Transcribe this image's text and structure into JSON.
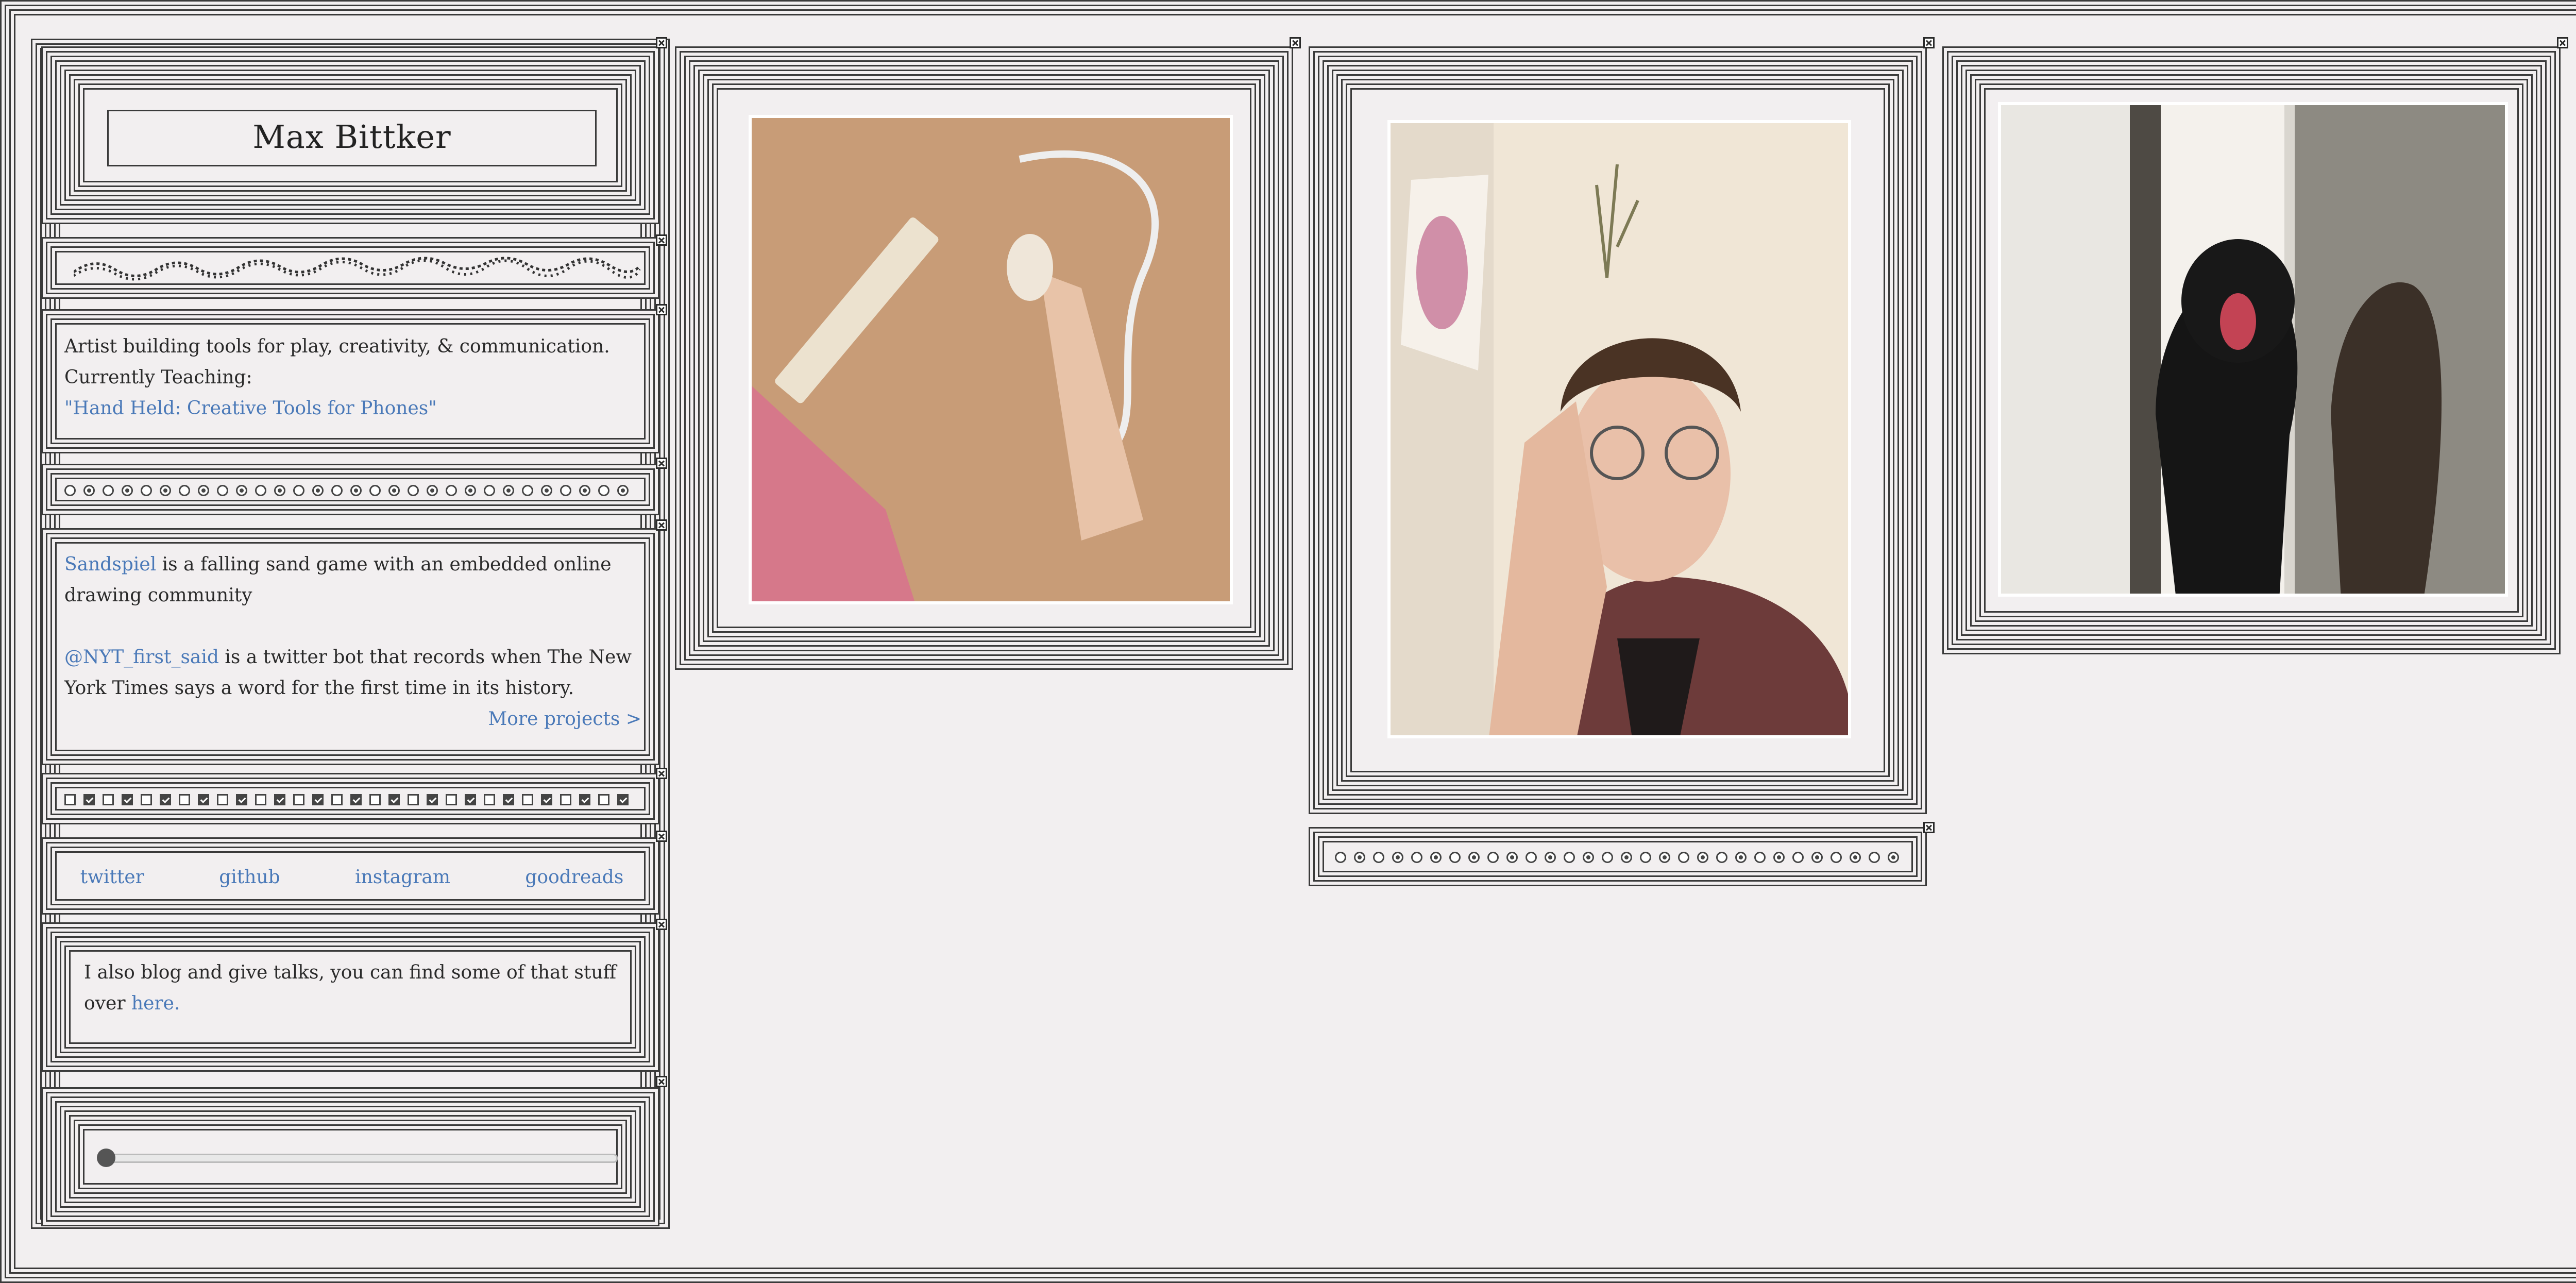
{
  "profile": {
    "name": "Max Bittker"
  },
  "bio": {
    "line1": "Artist building tools for play, creativity, & communication.",
    "line2": "Currently Teaching:",
    "course_link": "\"Hand Held: Creative Tools for Phones\""
  },
  "projects": {
    "p1_link": "Sandspiel",
    "p1_text": " is a falling sand game with an embedded online drawing community",
    "p2_link": "@NYT_first_said",
    "p2_text": " is a twitter bot that records when The New York Times says a word for the first time in its history.",
    "more": "More projects >"
  },
  "social": {
    "twitter": "twitter",
    "github": "github",
    "instagram": "instagram",
    "goodreads": "goodreads"
  },
  "blog": {
    "text": "I also blog and give talks, you can find some of that stuff over ",
    "link": "here."
  },
  "radio_row_1": [
    false,
    true,
    false,
    true,
    false,
    true,
    false,
    true,
    false,
    true,
    false,
    true,
    false,
    true,
    false,
    true,
    false,
    true,
    false,
    true,
    false,
    true,
    false,
    true,
    false,
    true,
    false,
    true,
    false,
    true
  ],
  "check_row": [
    false,
    true,
    false,
    true,
    false,
    true,
    false,
    true,
    false,
    true,
    false,
    true,
    false,
    true,
    false,
    true,
    false,
    true,
    false,
    true,
    false,
    true,
    false,
    true,
    false,
    true,
    false,
    true,
    false,
    true
  ],
  "radio_row_2": [
    false,
    true,
    false,
    true,
    false,
    true,
    false,
    true,
    false,
    true,
    false,
    true,
    false,
    true,
    false,
    true,
    false,
    true,
    false,
    true,
    false,
    true,
    false,
    true,
    false,
    true,
    false,
    true,
    false,
    true
  ],
  "slider": {
    "value": 0
  },
  "colors": {
    "background": "#f2eff0",
    "link": "#4a79b8",
    "line": "#3a3a3a"
  },
  "images": [
    {
      "name": "photo-power-strip",
      "alt": "hand plugging into power strip"
    },
    {
      "name": "photo-portrait",
      "alt": "person with glasses resting head on hand"
    },
    {
      "name": "photo-black-cat",
      "alt": "black cat yawning by window"
    }
  ]
}
